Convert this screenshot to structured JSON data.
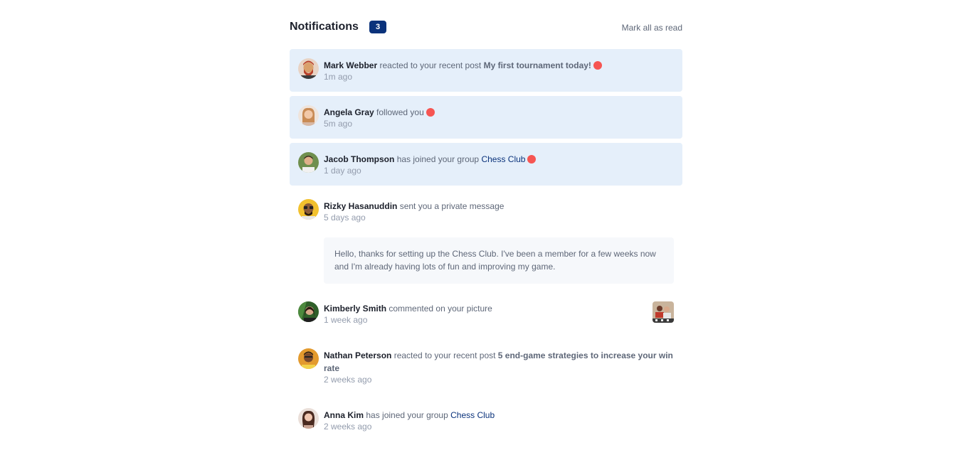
{
  "header": {
    "title": "Notifications",
    "unread_count": "3",
    "mark_all_label": "Mark all as read"
  },
  "notifications": [
    {
      "name": "Mark Webber",
      "action": "reacted to your recent post",
      "post": "My first tournament today!",
      "time": "1m ago",
      "unread": true
    },
    {
      "name": "Angela Gray",
      "action": "followed you",
      "time": "5m ago",
      "unread": true
    },
    {
      "name": "Jacob Thompson",
      "action": "has joined your group",
      "group": "Chess Club",
      "time": "1 day ago",
      "unread": true
    },
    {
      "name": "Rizky Hasanuddin",
      "action": "sent you a private message",
      "time": "5 days ago",
      "message": "Hello, thanks for setting up the Chess Club. I've been a member for a few weeks now and I'm already having lots of fun and improving my game.",
      "unread": false
    },
    {
      "name": "Kimberly Smith",
      "action": "commented on your picture",
      "time": "1 week ago",
      "unread": false
    },
    {
      "name": "Nathan Peterson",
      "action": "reacted to your recent post",
      "post": "5 end-game strategies to increase your win rate",
      "time": "2 weeks ago",
      "unread": false
    },
    {
      "name": "Anna Kim",
      "action": "has joined your group",
      "group": "Chess Club",
      "time": "2 weeks ago",
      "unread": false
    }
  ],
  "colors": {
    "unread_background": "#e5effa",
    "badge": "#0a327b",
    "unread_dot": "#f65552",
    "message_background": "#f6f8fb"
  }
}
